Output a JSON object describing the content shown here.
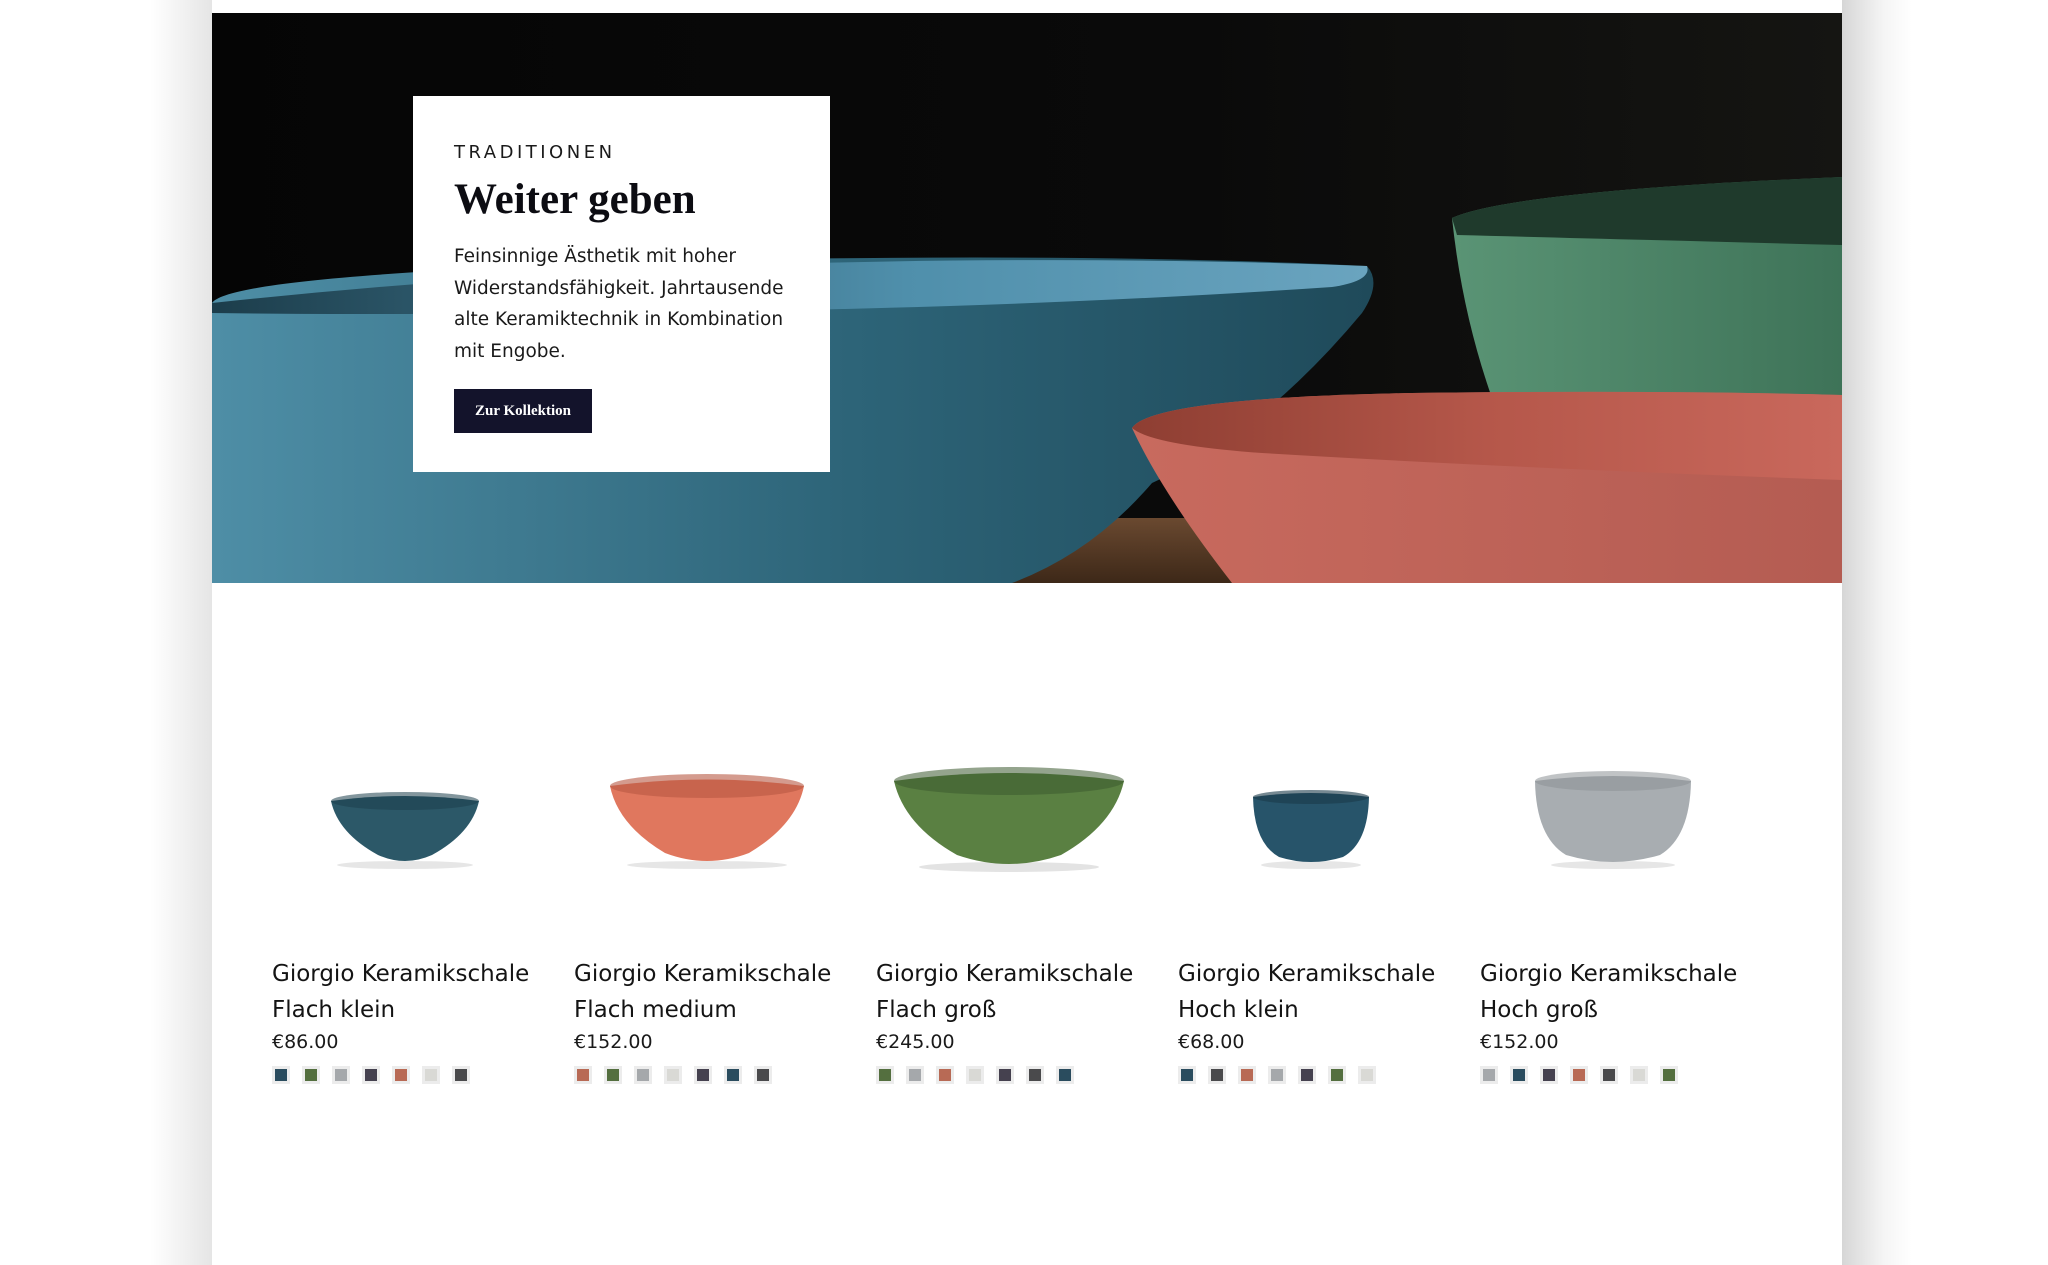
{
  "hero": {
    "eyebrow": "TRADITIONEN",
    "title": "Weiter geben",
    "text": "Feinsinnige Ästhetik mit hoher Widerstandsfähigkeit. Jahrtausende alte Keramiktechnik in Kombination mit Engobe.",
    "button_label": "Zur Kollektion"
  },
  "products": [
    {
      "name_line1": "Giorgio Keramikschale",
      "name_line2": "Flach klein",
      "price": "€86.00",
      "bowl_color": "#2c5868",
      "swatches": [
        "#2a4c5e",
        "#546f3f",
        "#a5a8ab",
        "#45414f",
        "#b86a55",
        "#d9d9d5",
        "#4a4a4c"
      ]
    },
    {
      "name_line1": "Giorgio Keramikschale",
      "name_line2": "Flach medium",
      "price": "€152.00",
      "bowl_color": "#e0775e",
      "swatches": [
        "#b86a55",
        "#546f3f",
        "#a5a8ab",
        "#d9d9d5",
        "#45414f",
        "#2a4c5e",
        "#4a4a4c"
      ]
    },
    {
      "name_line1": "Giorgio Keramikschale",
      "name_line2": "Flach groß",
      "price": "€245.00",
      "bowl_color": "#5a8042",
      "swatches": [
        "#546f3f",
        "#a5a8ab",
        "#b86a55",
        "#d9d9d5",
        "#45414f",
        "#4a4a4c",
        "#2a4c5e"
      ]
    },
    {
      "name_line1": "Giorgio Keramikschale",
      "name_line2": "Hoch klein",
      "price": "€68.00",
      "bowl_color": "#27546a",
      "swatches": [
        "#2a4c5e",
        "#4a4a4c",
        "#b86a55",
        "#a5a8ab",
        "#45414f",
        "#546f3f",
        "#d9d9d5"
      ]
    },
    {
      "name_line1": "Giorgio Keramikschale",
      "name_line2": "Hoch groß",
      "price": "€152.00",
      "bowl_color": "#a8adb1",
      "swatches": [
        "#a5a8ab",
        "#2a4c5e",
        "#45414f",
        "#b86a55",
        "#4a4a4c",
        "#d9d9d5",
        "#546f3f"
      ]
    }
  ]
}
